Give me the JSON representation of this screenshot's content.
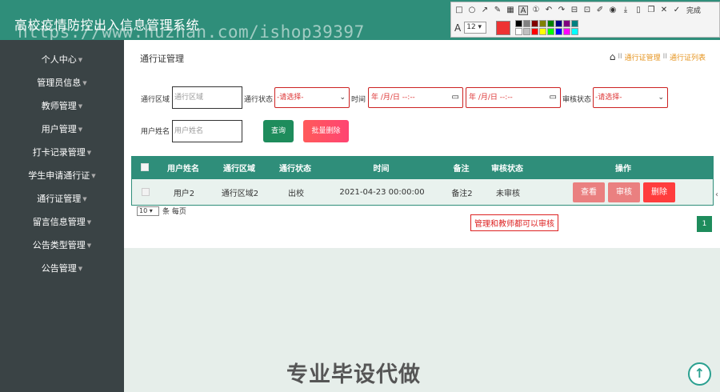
{
  "app": {
    "title": "高校疫情防控出入信息管理系统",
    "watermark": "https://www.huzhan.com/ishop39397"
  },
  "header": {
    "icons": [
      "expand-icon",
      "user-icon"
    ]
  },
  "annotation_toolbar": {
    "tools": [
      "rectangle-icon",
      "ellipse-icon",
      "arrow-icon",
      "pen-icon",
      "mosaic-icon",
      "text-icon",
      "number-icon",
      "undo-icon",
      "redo-icon",
      "pin-icon",
      "screenshot-icon",
      "color-picker-icon",
      "record-icon",
      "save-icon",
      "phone-icon",
      "copy-icon",
      "close-icon",
      "check-icon"
    ],
    "done_label": "完成",
    "font_glyph": "A",
    "font_size": "12",
    "selected_color": "#ee3333",
    "palette": [
      "#000000",
      "#808080",
      "#800000",
      "#808000",
      "#008000",
      "#000080",
      "#800080",
      "#008080",
      "#ffffff",
      "#c0c0c0",
      "#ff0000",
      "#ffff00",
      "#00ff00",
      "#0000ff",
      "#ff00ff",
      "#00ffff"
    ]
  },
  "sidebar": {
    "items": [
      {
        "label": "个人中心"
      },
      {
        "label": "管理员信息"
      },
      {
        "label": "教师管理"
      },
      {
        "label": "用户管理"
      },
      {
        "label": "打卡记录管理"
      },
      {
        "label": "学生申请通行证"
      },
      {
        "label": "通行证管理"
      },
      {
        "label": "留言信息管理"
      },
      {
        "label": "公告类型管理"
      },
      {
        "label": "公告管理"
      }
    ]
  },
  "page": {
    "title": "通行证管理",
    "breadcrumb": [
      "通行证管理",
      "通行证列表"
    ],
    "breadcrumb_sep": "II"
  },
  "filters": {
    "area_label": "通行区域",
    "area_placeholder": "通行区域",
    "status_label": "通行状态",
    "status_value": "-请选择-",
    "time_label": "时间",
    "date_from": "年 /月/日 --:--",
    "date_to": "年 /月/日 --:--",
    "audit_label": "审核状态",
    "audit_value": "-请选择-",
    "name_label": "用户姓名",
    "name_placeholder": "用户姓名",
    "search_button": "查询",
    "batch_delete_button": "批量删除"
  },
  "table": {
    "columns": [
      "用户姓名",
      "通行区域",
      "通行状态",
      "时间",
      "备注",
      "审核状态",
      "操作"
    ],
    "rows": [
      {
        "name": "用户2",
        "area": "通行区域2",
        "status": "出校",
        "time": "2021-04-23 00:00:00",
        "note": "备注2",
        "audit": "未审核"
      }
    ],
    "actions": [
      "查看",
      "审核",
      "删除"
    ]
  },
  "pagination": {
    "page_size": "10",
    "per_page_label": "条 每页",
    "current_page": "1"
  },
  "annotation_note": "管理和教师都可以审核",
  "footer_text": "专业毕设代做"
}
